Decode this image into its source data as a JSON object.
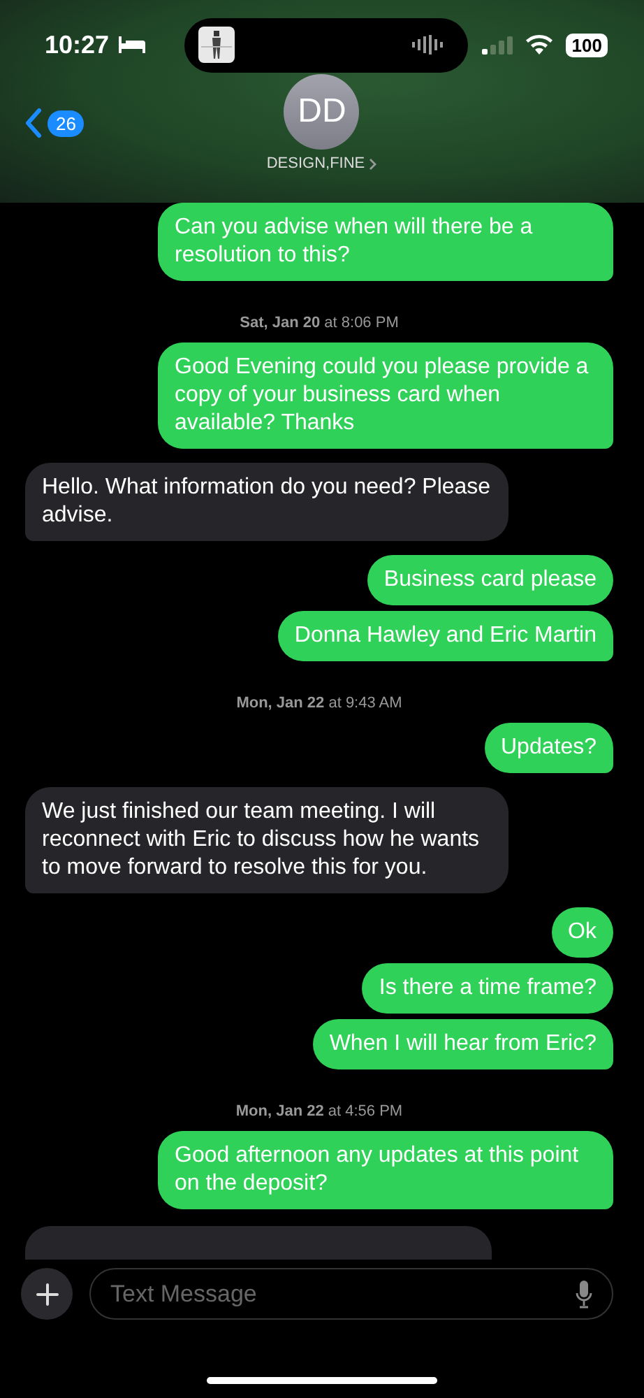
{
  "status_bar": {
    "time": "10:27",
    "battery": "100"
  },
  "header": {
    "unread_count": "26",
    "avatar_initials": "DD",
    "contact_name": "DESIGN,FINE"
  },
  "messages": [
    {
      "kind": "out",
      "text": "Can you advise when will there be a resolution to this?",
      "tail": true
    },
    {
      "kind": "time",
      "text": "**Sat, Jan 20** at 8:06 PM"
    },
    {
      "kind": "out",
      "text": "Good Evening could you please provide a copy of your business card when available? Thanks",
      "tail": true
    },
    {
      "kind": "in",
      "text": "Hello. What information do you need? Please advise.",
      "tail": true
    },
    {
      "kind": "out",
      "text": "Business card please",
      "tail": false
    },
    {
      "kind": "out",
      "text": "Donna Hawley and Eric Martin",
      "tail": true
    },
    {
      "kind": "time",
      "text": "**Mon, Jan 22** at 9:43 AM"
    },
    {
      "kind": "out",
      "text": "Updates?",
      "tail": true
    },
    {
      "kind": "in",
      "text": "We just finished our team meeting. I will reconnect with Eric to discuss how he wants to move forward to resolve this for you.",
      "tail": true
    },
    {
      "kind": "out",
      "text": "Ok",
      "tail": false
    },
    {
      "kind": "out",
      "text": "Is there a time frame?",
      "tail": false
    },
    {
      "kind": "out",
      "text": "When I will hear from Eric?",
      "tail": true
    },
    {
      "kind": "time",
      "text": "**Mon, Jan 22** at 4:56 PM"
    },
    {
      "kind": "out",
      "text": "Good afternoon any updates at this point on the deposit?",
      "tail": true
    }
  ],
  "composer": {
    "placeholder": "Text Message"
  }
}
